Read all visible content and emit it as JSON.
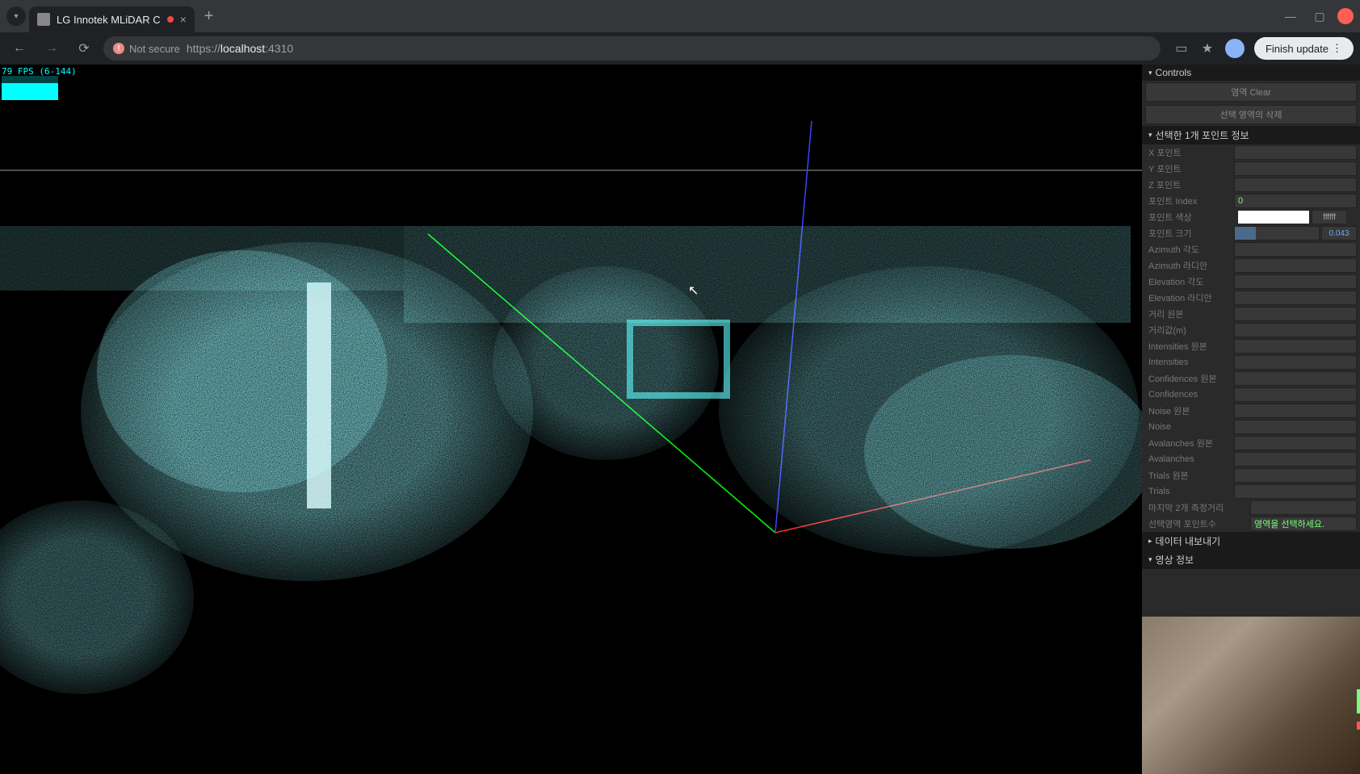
{
  "browser": {
    "tab_title": "LG Innotek MLiDAR C",
    "url_scheme": "https://",
    "url_host": "localhost",
    "url_port": ":4310",
    "not_secure": "Not secure",
    "finish_update": "Finish update"
  },
  "fps": {
    "text": "79 FPS (6-144)"
  },
  "sidebar": {
    "controls_header": "Controls",
    "button_clear": "영역 Clear",
    "button_hidden": "선택 영역의 삭제",
    "section_point_info": "선택한 1개 포인트 정보",
    "rows": {
      "x_point": "X 포인트",
      "y_point": "Y 포인트",
      "z_point": "Z 포인트",
      "point_index": "포인트 Index",
      "point_index_val": "0",
      "point_color": "포인트 색상",
      "point_color_hex": "ffffff",
      "point_size": "포인트 크기",
      "point_size_val": "0.043",
      "azimuth_deg": "Azimuth 각도",
      "azimuth_rad": "Azimuth 라디안",
      "elevation_deg": "Elevation 각도",
      "elevation_rad": "Elevation 라디안",
      "dist_raw": "거리 원본",
      "dist_m": "거리값(m)",
      "intensities_raw": "Intensities 원본",
      "intensities": "Intensities",
      "confidences_raw": "Confidences 원본",
      "confidences": "Confidences",
      "noise_raw": "Noise 원본",
      "noise": "Noise",
      "avalanches_raw": "Avalanches 원본",
      "avalanches": "Avalanches",
      "trials_raw": "Trials 원본",
      "trials": "Trials",
      "last_measure": "마지막 2개 측정거리",
      "selected_points": "선택영역 포인트수",
      "selected_points_hint": "영역을 선택하세요."
    },
    "section_export": "데이터 내보내기",
    "section_video": "영상 정보"
  }
}
